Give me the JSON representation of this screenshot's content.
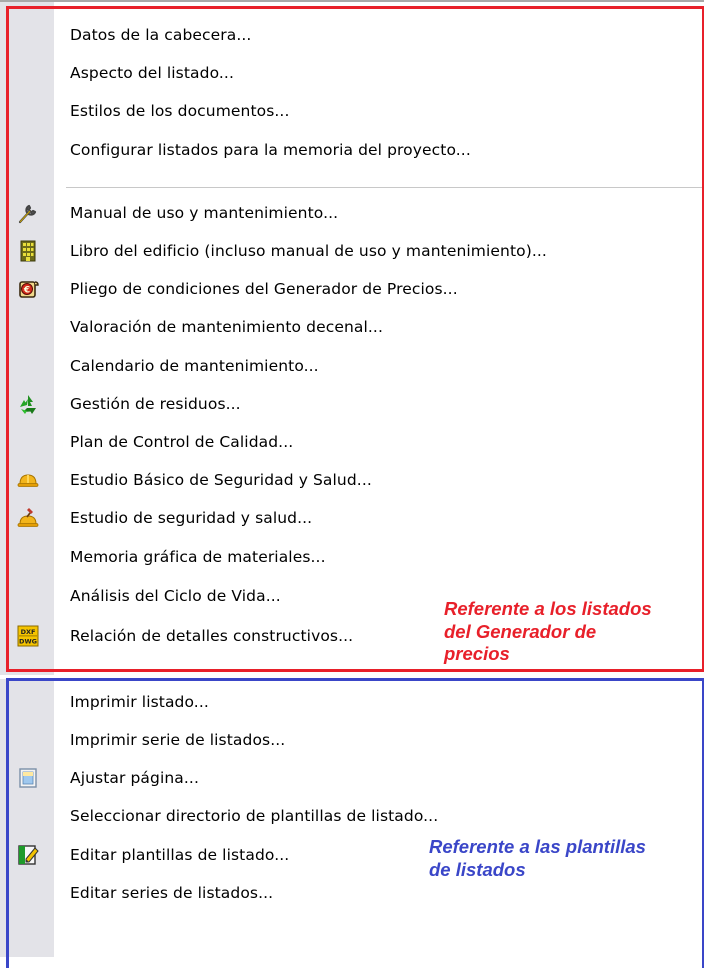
{
  "menu": {
    "items": [
      {
        "label": "Datos de la cabecera..."
      },
      {
        "label": "Aspecto del listado..."
      },
      {
        "label": "Estilos de los documentos..."
      },
      {
        "label": "Configurar listados para la memoria del proyecto..."
      },
      {
        "label": "Manual de uso y mantenimiento...",
        "icon": "wrench-icon"
      },
      {
        "label": "Libro del edificio (incluso manual de uso y mantenimiento)...",
        "icon": "building-icon"
      },
      {
        "label": "Pliego de condiciones del Generador de Precios...",
        "icon": "scroll-euro-icon"
      },
      {
        "label": "Valoración de mantenimiento decenal..."
      },
      {
        "label": "Calendario de mantenimiento..."
      },
      {
        "label": "Gestión de residuos...",
        "icon": "recycle-icon"
      },
      {
        "label": "Plan de Control de Calidad..."
      },
      {
        "label": "Estudio Básico de Seguridad y Salud...",
        "icon": "hardhat-icon"
      },
      {
        "label": "Estudio de seguridad y salud...",
        "icon": "hardhat-hammer-icon"
      },
      {
        "label": "Memoria gráfica de materiales..."
      },
      {
        "label": "Análisis del Ciclo de Vida..."
      },
      {
        "label": "Relación de detalles constructivos...",
        "icon": "dxf-dwg-icon"
      },
      {
        "label": "Imprimir listado..."
      },
      {
        "label": "Imprimir serie de listados..."
      },
      {
        "label": "Ajustar página...",
        "icon": "page-setup-icon"
      },
      {
        "label": "Seleccionar directorio de plantillas de listado..."
      },
      {
        "label": "Editar plantillas de listado...",
        "icon": "edit-template-icon"
      },
      {
        "label": "Editar series de listados..."
      }
    ],
    "dxf_icon_text": {
      "top": "DXF",
      "bottom": "DWG"
    }
  },
  "annotations": {
    "generator": {
      "lines": [
        "Referente a los listados",
        "del Generador de",
        "precios"
      ],
      "color": "#e8202a"
    },
    "templates": {
      "lines": [
        "Referente a las plantillas",
        "de listados"
      ],
      "color": "#3a46c8"
    }
  },
  "colors": {
    "gutter": "#e3e3e8",
    "red_frame": "#e8202a",
    "blue_frame": "#3a46c8"
  }
}
